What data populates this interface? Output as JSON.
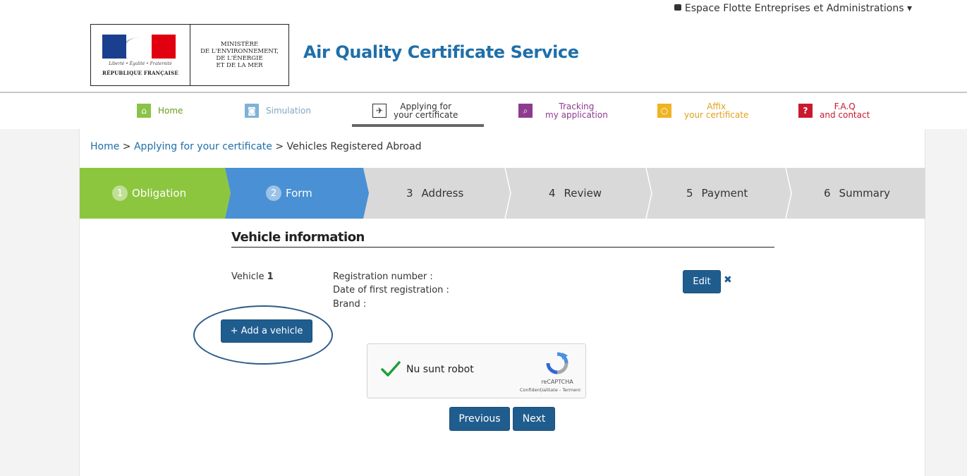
{
  "account": {
    "label": "Espace Flotte Entreprises et Administrations ▾"
  },
  "logo": {
    "devise": "Liberté • Égalité • Fraternité",
    "republic": "RÉPUBLIQUE FRANÇAISE",
    "ministry": [
      "MINISTÈRE",
      "DE L'ENVIRONNEMENT,",
      "DE L'ÉNERGIE",
      "ET DE LA MER"
    ]
  },
  "site_title": "Air Quality Certificate Service",
  "nav": [
    {
      "id": "home",
      "label1": "Home",
      "label2": "",
      "color": "#8bc34a",
      "icon": "home-icon",
      "glyph": "⌂",
      "text_color": "#6b9a1a",
      "active": false
    },
    {
      "id": "simulation",
      "label1": "Simulation",
      "label2": "",
      "color": "#7fb2d6",
      "icon": "car-icon",
      "glyph": "◙",
      "text_color": "#7fa6c2",
      "active": false
    },
    {
      "id": "applying",
      "label1": "Applying for",
      "label2": "your certificate",
      "color": "#ffffff",
      "icon": "paper-plane-icon",
      "glyph": "✈",
      "text_color": "#333333",
      "active": true
    },
    {
      "id": "tracking",
      "label1": "Tracking",
      "label2": "my application",
      "color": "#8e3a8f",
      "icon": "search-icon",
      "glyph": "⌕",
      "text_color": "#8e3a8f",
      "active": false
    },
    {
      "id": "affix",
      "label1": "Affix",
      "label2": "your certificate",
      "color": "#f0b323",
      "icon": "circle-icon",
      "glyph": "○",
      "text_color": "#e0a11a",
      "active": false
    },
    {
      "id": "faq",
      "label1": "F.A.Q",
      "label2": "and contact",
      "color": "#c9192e",
      "icon": "question-icon",
      "glyph": "?",
      "text_color": "#c9192e",
      "active": false
    }
  ],
  "breadcrumb": {
    "home": "Home",
    "sep": " > ",
    "applying": "Applying for your certificate",
    "current": "Vehicles Registered Abroad"
  },
  "steps": [
    {
      "num": "1",
      "label": "Obligation",
      "state": "done"
    },
    {
      "num": "2",
      "label": "Form",
      "state": "current"
    },
    {
      "num": "3",
      "label": "Address",
      "state": "todo"
    },
    {
      "num": "4",
      "label": "Review",
      "state": "todo"
    },
    {
      "num": "5",
      "label": "Payment",
      "state": "todo"
    },
    {
      "num": "6",
      "label": "Summary",
      "state": "todo"
    }
  ],
  "colors": {
    "done": "#8cc63f",
    "current": "#4a90d4",
    "todo": "#d9d9d9",
    "primary": "#205d8f"
  },
  "section_title": "Vehicle information",
  "vehicle": {
    "label": "Vehicle",
    "number": "1",
    "fields": [
      "Registration number :",
      "Date of first registration :",
      "Brand :"
    ]
  },
  "buttons": {
    "edit": "Edit",
    "remove": "✖",
    "add_vehicle": "+ Add a vehicle",
    "previous": "Previous",
    "next": "Next"
  },
  "captcha": {
    "label": "Nu sunt robot",
    "brand": "reCAPTCHA",
    "links": "Confidențialitate - Termeni"
  }
}
